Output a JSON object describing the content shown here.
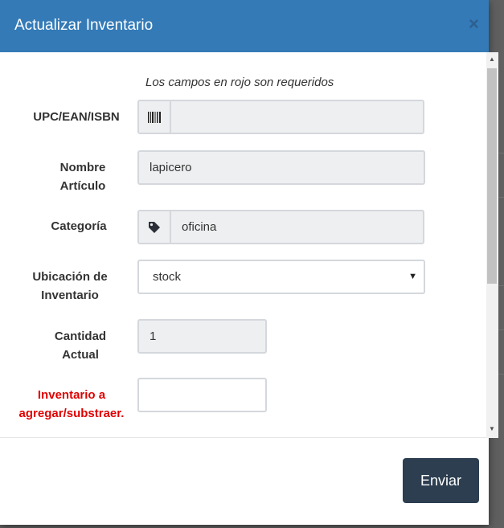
{
  "modal": {
    "title": "Actualizar Inventario",
    "close_label": "×"
  },
  "form": {
    "required_note": "Los campos en rojo son requeridos",
    "fields": {
      "upc": {
        "label": "UPC/EAN/ISBN",
        "value": "",
        "icon": "barcode-icon"
      },
      "name": {
        "label_line1": "Nombre",
        "label_line2": "Artículo",
        "value": "lapicero"
      },
      "category": {
        "label": "Categoría",
        "value": "oficina",
        "icon": "tag-icon"
      },
      "location": {
        "label_line1": "Ubicación de",
        "label_line2": "Inventario",
        "value": "stock"
      },
      "quantity": {
        "label_line1": "Cantidad",
        "label_line2": "Actual",
        "value": "1"
      },
      "adjust": {
        "label_line1": "Inventario a",
        "label_line2": "agregar/substraer.",
        "value": ""
      }
    }
  },
  "footer": {
    "submit_label": "Enviar"
  },
  "colors": {
    "header": "#337ab7",
    "submit": "#2c3e50",
    "required": "#e00000"
  }
}
